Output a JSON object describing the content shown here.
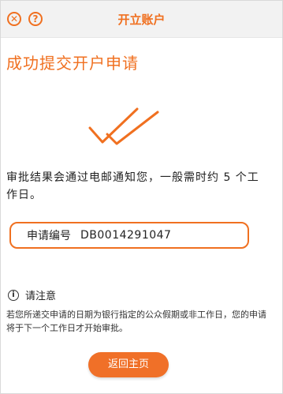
{
  "header": {
    "title": "开立账户",
    "close_icon": "close-icon",
    "help_icon": "help-icon",
    "close_glyph": "✕",
    "help_glyph": "?"
  },
  "main": {
    "heading": "成功提交开户申请",
    "success_icon": "double-check-icon",
    "notice": "审批结果会通过电邮通知您，一般需时约 5 个工作日。",
    "application": {
      "label": "申请编号",
      "number": "DB0014291047"
    },
    "note": {
      "icon": "info-icon",
      "icon_glyph": "i",
      "title": "请注意",
      "body": "若您所递交申请的日期为银行指定的公众假期或非工作日，您的申请将于下一个工作日才开始审批。"
    },
    "home_button": "返回主页"
  },
  "colors": {
    "accent": "#f07020",
    "header_bg": "#f2f2f2"
  }
}
